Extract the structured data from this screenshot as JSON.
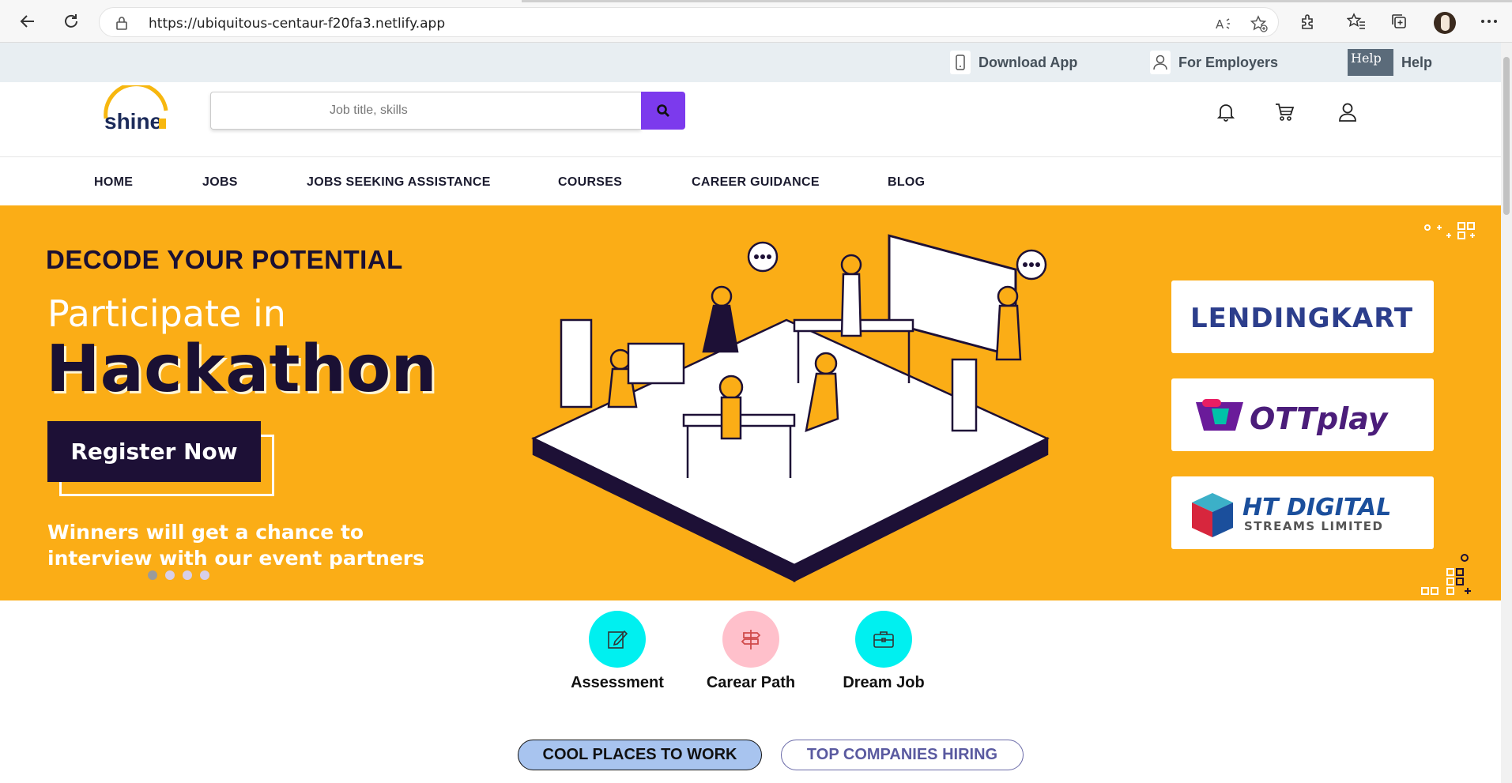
{
  "browser": {
    "url": "https://ubiquitous-centaur-f20fa3.netlify.app",
    "icons": [
      "back-icon",
      "reload-icon",
      "lock-icon",
      "read-aloud-icon",
      "add-favorite-icon",
      "extensions-icon",
      "favorites-icon",
      "collections-icon",
      "profile-avatar",
      "more-icon"
    ]
  },
  "utility_bar": {
    "download_app": "Download App",
    "for_employers": "For Employers",
    "help_img_alt": "Help",
    "help": "Help"
  },
  "header": {
    "logo_text": "shine",
    "search_placeholder": "Job title, skills",
    "search_icon": "search-icon",
    "icons": [
      "bell-icon",
      "cart-icon",
      "user-icon"
    ]
  },
  "nav": {
    "items": [
      "HOME",
      "JOBS",
      "JOBS SEEKING ASSISTANCE",
      "COURSES",
      "CAREER GUIDANCE",
      "BLOG"
    ]
  },
  "banner": {
    "eyebrow": "DECODE YOUR POTENTIAL",
    "subtitle": "Participate in",
    "title": "Hackathon",
    "cta": "Register Now",
    "footer_line1": "Winners will get a chance to",
    "footer_line2": "interview with our event partners",
    "slides": 4,
    "active_slide": 1,
    "partners": [
      {
        "name": "LENDINGKART",
        "brand_color": "#2c3e8c",
        "accent": "#f39c12"
      },
      {
        "name": "OTTplay",
        "brand_color": "#4b1d7a",
        "accent": "#e91e63"
      },
      {
        "name": "HT DIGITAL",
        "tagline": "STREAMS LIMITED",
        "brand_color": "#1b4f9c",
        "accent": "#3cb0c8"
      }
    ],
    "colors": {
      "background": "#fbad16",
      "dark": "#1d1036"
    }
  },
  "quick_actions": [
    {
      "label": "Assessment",
      "icon": "edit-icon",
      "color": "#00f0f0"
    },
    {
      "label": "Carear Path",
      "icon": "signpost-icon",
      "color": "#ffc0cb"
    },
    {
      "label": "Dream Job",
      "icon": "briefcase-icon",
      "color": "#00f0f0"
    }
  ],
  "tabs": [
    {
      "label": "COOL PLACES TO WORK",
      "active": true
    },
    {
      "label": "TOP COMPANIES HIRING",
      "active": false
    }
  ],
  "colors": {
    "accent_purple": "#7c3aed",
    "util_bar": "#e8eef2",
    "tab_active": "#a8c4ef",
    "tab_inactive_text": "#5a5aa0"
  }
}
